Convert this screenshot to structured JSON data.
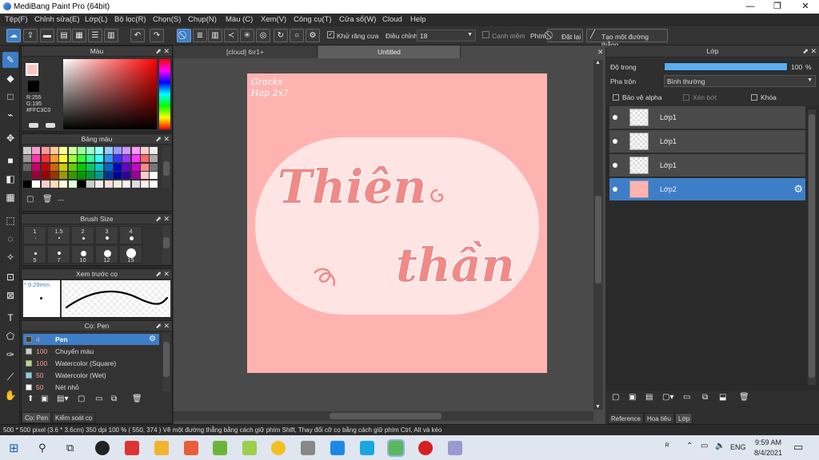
{
  "window": {
    "title": "MediBang Paint Pro (64bit)",
    "min": "—",
    "max": "❐",
    "close": "✕"
  },
  "menu": [
    "Tệp(F)",
    "Chỉnh sửa(E)",
    "Lớp(L)",
    "Bộ lọc(R)",
    "Chọn(S)",
    "Chụp(N)",
    "Màu (C)",
    "Xem(V)",
    "Công cụ(T)",
    "Cửa sổ(W)",
    "Cloud",
    "Help"
  ],
  "toolbar": {
    "antialias_label": "Khử răng cưa",
    "correction_label": "Điều chỉnh",
    "correction_value": "18",
    "canh_mem_label": "Cạnh mềm",
    "phim_label": "Phím",
    "reset_label": "Đặt lại",
    "new_line_label": "Tạo một đường thẳng"
  },
  "color_panel": {
    "title": "Màu",
    "r": "R:255",
    "g": "G:195",
    "b": "B:192",
    "hex": "#FFC3C0",
    "current_color": "#FFC3C0",
    "secondary_color": "#000000"
  },
  "palette_panel": {
    "title": "Bảng màu",
    "footer": "---"
  },
  "brush_size_panel": {
    "title": "Brush Size",
    "top_sizes": [
      "1",
      "1.5",
      "2",
      "3",
      "4"
    ],
    "bottom_sizes": [
      "5",
      "7",
      "10",
      "12",
      "15"
    ]
  },
  "preview_panel": {
    "title": "Xem trước cọ",
    "size": "* 0.29mm"
  },
  "brush_panel": {
    "title": "Cọ: Pen",
    "brushes": [
      {
        "size": "4",
        "name": "Pen",
        "color": "#3c3c3c"
      },
      {
        "size": "100",
        "name": "Chuyển màu",
        "color": "#cccccc"
      },
      {
        "size": "100",
        "name": "Watercolor (Square)",
        "color": "#b8e07a"
      },
      {
        "size": "50",
        "name": "Watercolor (Wet)",
        "color": "#7ed0f0"
      },
      {
        "size": "50",
        "name": "Nét nhỏ",
        "color": "#ffffff"
      }
    ],
    "tabs": [
      "Cọ: Pen",
      "Kiểm soát cọ"
    ]
  },
  "doc_tabs": [
    "[cloud] 6ır1+",
    "Untitled"
  ],
  "canvas": {
    "signature_line1": "Gracks",
    "signature_line2": "Hap 2x7",
    "word1": "Thiên",
    "word2": "thần",
    "bg": "#FFB3B0",
    "pill": "#FFE4E4",
    "text_color": "#F08A88"
  },
  "layer_panel": {
    "title": "Lớp",
    "opacity_label": "Độ trong",
    "opacity_value": "100",
    "opacity_unit": "%",
    "blend_label": "Pha trộn",
    "blend_value": "Bình thường",
    "protect_alpha": "Bảo vệ alpha",
    "clip": "Xén bớt",
    "lock": "Khóa",
    "layers": [
      {
        "name": "Lớp1"
      },
      {
        "name": "Lớp1"
      },
      {
        "name": "Lớp1"
      },
      {
        "name": "Lớp2"
      }
    ],
    "tabs": [
      "Reference",
      "Hoa tiêu",
      "Lớp"
    ]
  },
  "status": {
    "text": "500 * 500 pixel   (3.6 * 3.6cm)   350 dpi   100 %   ( 550, 374 )   Vẽ một đường thẳng bằng cách giữ phím Shift, Thay đổi cỡ cọ bằng cách giữ phím Ctrl, Alt và kéo"
  },
  "taskbar": {
    "time": "9:59 AM",
    "date": "8/4/2021",
    "lang": "ENG"
  },
  "colors": {
    "accent": "#3d7ec6",
    "panel_bg": "#333333",
    "canvas_bg": "#4a4a4a"
  }
}
